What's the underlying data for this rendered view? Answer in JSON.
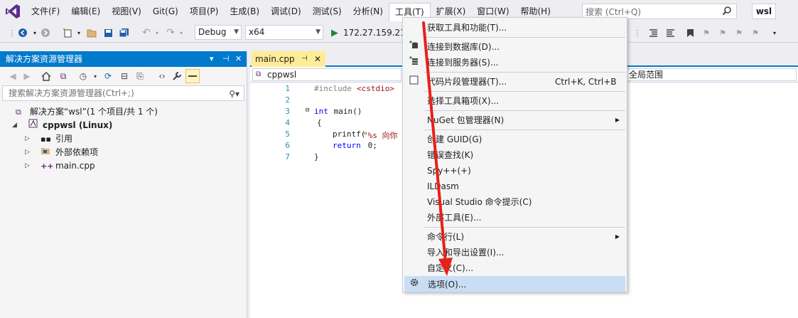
{
  "menubar": {
    "items": [
      "文件(F)",
      "编辑(E)",
      "视图(V)",
      "Git(G)",
      "项目(P)",
      "生成(B)",
      "调试(D)",
      "测试(S)",
      "分析(N)",
      "工具(T)",
      "扩展(X)",
      "窗口(W)",
      "帮助(H)"
    ],
    "search_placeholder": "搜索 (Ctrl+Q)",
    "context_badge": "wsl"
  },
  "toolbar": {
    "config": "Debug",
    "platform": "x64",
    "target": "172.27.159.210"
  },
  "solution_explorer": {
    "title": "解决方案资源管理器",
    "search_placeholder": "搜索解决方案资源管理器(Ctrl+;)",
    "solution": "解决方案“wsl”(1 个项目/共 1 个)",
    "project": "cppwsl (Linux)",
    "items": [
      "引用",
      "外部依赖项",
      "main.cpp"
    ]
  },
  "editor": {
    "tab_name": "main.cpp",
    "nav_project": "cppwsl",
    "nav_scope": "全局范围",
    "line_numbers": [
      "1",
      "2",
      "3",
      "4",
      "5",
      "6",
      "7"
    ],
    "code": {
      "l1_directive": "#include",
      "l1_header": "<cstdio>",
      "l3_kw": "int",
      "l3_rest": " main()",
      "l4": "{",
      "l5_fn": "printf(",
      "l5_str": "\"%s 向你",
      "l6_kw": "return",
      "l6_rest": " 0;",
      "l7": "}"
    }
  },
  "tools_menu": {
    "items": [
      {
        "label": "获取工具和功能(T)...",
        "shortcut": "",
        "icon": ""
      },
      {
        "label": "连接到数据库(D)...",
        "shortcut": "",
        "icon": "database-icon"
      },
      {
        "label": "连接到服务器(S)...",
        "shortcut": "",
        "icon": "server-icon"
      },
      {
        "label": "代码片段管理器(T)...",
        "shortcut": "Ctrl+K, Ctrl+B",
        "icon": "checkbox-icon"
      },
      {
        "label": "选择工具箱项(X)...",
        "shortcut": "",
        "icon": ""
      },
      {
        "label": "NuGet 包管理器(N)",
        "shortcut": "",
        "icon": ""
      },
      {
        "label": "创建 GUID(G)",
        "shortcut": "",
        "icon": ""
      },
      {
        "label": "错误查找(K)",
        "shortcut": "",
        "icon": ""
      },
      {
        "label": "Spy++(+)",
        "shortcut": "",
        "icon": ""
      },
      {
        "label": "ILDasm",
        "shortcut": "",
        "icon": ""
      },
      {
        "label": "Visual Studio 命令提示(C)",
        "shortcut": "",
        "icon": ""
      },
      {
        "label": "外部工具(E)...",
        "shortcut": "",
        "icon": ""
      },
      {
        "label": "命令行(L)",
        "shortcut": "",
        "icon": ""
      },
      {
        "label": "导入和导出设置(I)...",
        "shortcut": "",
        "icon": ""
      },
      {
        "label": "自定义(C)...",
        "shortcut": "",
        "icon": ""
      },
      {
        "label": "选项(O)...",
        "shortcut": "",
        "icon": "gear-icon"
      }
    ]
  },
  "colors": {
    "accent": "#007acc",
    "active_tab": "#ffec97",
    "highlight": "#c9def5",
    "annotation_arrow": "#e8201b"
  }
}
